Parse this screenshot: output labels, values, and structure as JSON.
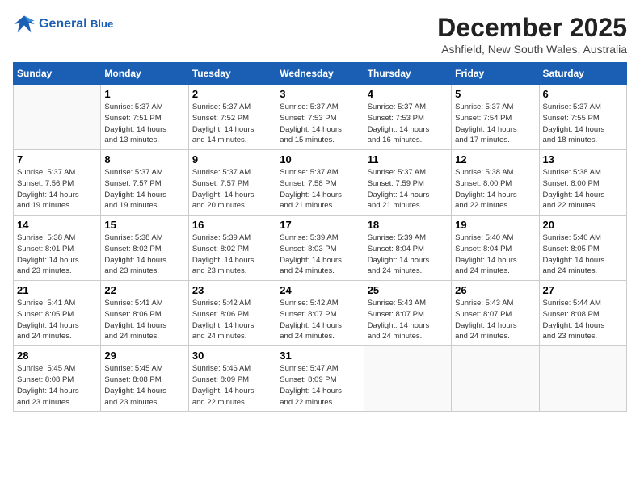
{
  "logo": {
    "line1": "General",
    "line2": "Blue"
  },
  "title": "December 2025",
  "location": "Ashfield, New South Wales, Australia",
  "weekdays": [
    "Sunday",
    "Monday",
    "Tuesday",
    "Wednesday",
    "Thursday",
    "Friday",
    "Saturday"
  ],
  "weeks": [
    [
      {
        "day": "",
        "info": ""
      },
      {
        "day": "1",
        "info": "Sunrise: 5:37 AM\nSunset: 7:51 PM\nDaylight: 14 hours\nand 13 minutes."
      },
      {
        "day": "2",
        "info": "Sunrise: 5:37 AM\nSunset: 7:52 PM\nDaylight: 14 hours\nand 14 minutes."
      },
      {
        "day": "3",
        "info": "Sunrise: 5:37 AM\nSunset: 7:53 PM\nDaylight: 14 hours\nand 15 minutes."
      },
      {
        "day": "4",
        "info": "Sunrise: 5:37 AM\nSunset: 7:53 PM\nDaylight: 14 hours\nand 16 minutes."
      },
      {
        "day": "5",
        "info": "Sunrise: 5:37 AM\nSunset: 7:54 PM\nDaylight: 14 hours\nand 17 minutes."
      },
      {
        "day": "6",
        "info": "Sunrise: 5:37 AM\nSunset: 7:55 PM\nDaylight: 14 hours\nand 18 minutes."
      }
    ],
    [
      {
        "day": "7",
        "info": "Sunrise: 5:37 AM\nSunset: 7:56 PM\nDaylight: 14 hours\nand 19 minutes."
      },
      {
        "day": "8",
        "info": "Sunrise: 5:37 AM\nSunset: 7:57 PM\nDaylight: 14 hours\nand 19 minutes."
      },
      {
        "day": "9",
        "info": "Sunrise: 5:37 AM\nSunset: 7:57 PM\nDaylight: 14 hours\nand 20 minutes."
      },
      {
        "day": "10",
        "info": "Sunrise: 5:37 AM\nSunset: 7:58 PM\nDaylight: 14 hours\nand 21 minutes."
      },
      {
        "day": "11",
        "info": "Sunrise: 5:37 AM\nSunset: 7:59 PM\nDaylight: 14 hours\nand 21 minutes."
      },
      {
        "day": "12",
        "info": "Sunrise: 5:38 AM\nSunset: 8:00 PM\nDaylight: 14 hours\nand 22 minutes."
      },
      {
        "day": "13",
        "info": "Sunrise: 5:38 AM\nSunset: 8:00 PM\nDaylight: 14 hours\nand 22 minutes."
      }
    ],
    [
      {
        "day": "14",
        "info": "Sunrise: 5:38 AM\nSunset: 8:01 PM\nDaylight: 14 hours\nand 23 minutes."
      },
      {
        "day": "15",
        "info": "Sunrise: 5:38 AM\nSunset: 8:02 PM\nDaylight: 14 hours\nand 23 minutes."
      },
      {
        "day": "16",
        "info": "Sunrise: 5:39 AM\nSunset: 8:02 PM\nDaylight: 14 hours\nand 23 minutes."
      },
      {
        "day": "17",
        "info": "Sunrise: 5:39 AM\nSunset: 8:03 PM\nDaylight: 14 hours\nand 24 minutes."
      },
      {
        "day": "18",
        "info": "Sunrise: 5:39 AM\nSunset: 8:04 PM\nDaylight: 14 hours\nand 24 minutes."
      },
      {
        "day": "19",
        "info": "Sunrise: 5:40 AM\nSunset: 8:04 PM\nDaylight: 14 hours\nand 24 minutes."
      },
      {
        "day": "20",
        "info": "Sunrise: 5:40 AM\nSunset: 8:05 PM\nDaylight: 14 hours\nand 24 minutes."
      }
    ],
    [
      {
        "day": "21",
        "info": "Sunrise: 5:41 AM\nSunset: 8:05 PM\nDaylight: 14 hours\nand 24 minutes."
      },
      {
        "day": "22",
        "info": "Sunrise: 5:41 AM\nSunset: 8:06 PM\nDaylight: 14 hours\nand 24 minutes."
      },
      {
        "day": "23",
        "info": "Sunrise: 5:42 AM\nSunset: 8:06 PM\nDaylight: 14 hours\nand 24 minutes."
      },
      {
        "day": "24",
        "info": "Sunrise: 5:42 AM\nSunset: 8:07 PM\nDaylight: 14 hours\nand 24 minutes."
      },
      {
        "day": "25",
        "info": "Sunrise: 5:43 AM\nSunset: 8:07 PM\nDaylight: 14 hours\nand 24 minutes."
      },
      {
        "day": "26",
        "info": "Sunrise: 5:43 AM\nSunset: 8:07 PM\nDaylight: 14 hours\nand 24 minutes."
      },
      {
        "day": "27",
        "info": "Sunrise: 5:44 AM\nSunset: 8:08 PM\nDaylight: 14 hours\nand 23 minutes."
      }
    ],
    [
      {
        "day": "28",
        "info": "Sunrise: 5:45 AM\nSunset: 8:08 PM\nDaylight: 14 hours\nand 23 minutes."
      },
      {
        "day": "29",
        "info": "Sunrise: 5:45 AM\nSunset: 8:08 PM\nDaylight: 14 hours\nand 23 minutes."
      },
      {
        "day": "30",
        "info": "Sunrise: 5:46 AM\nSunset: 8:09 PM\nDaylight: 14 hours\nand 22 minutes."
      },
      {
        "day": "31",
        "info": "Sunrise: 5:47 AM\nSunset: 8:09 PM\nDaylight: 14 hours\nand 22 minutes."
      },
      {
        "day": "",
        "info": ""
      },
      {
        "day": "",
        "info": ""
      },
      {
        "day": "",
        "info": ""
      }
    ]
  ]
}
